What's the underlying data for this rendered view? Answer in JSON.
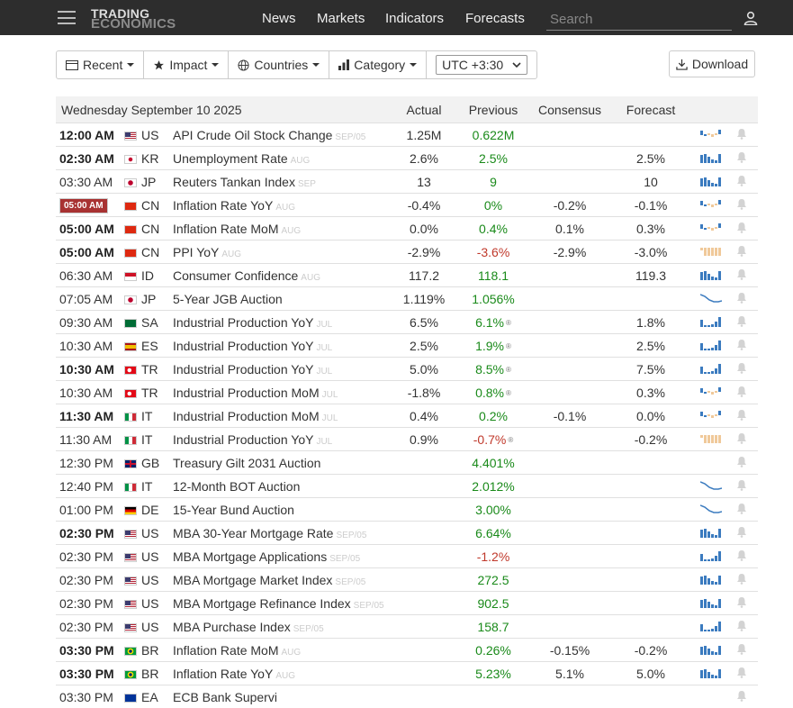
{
  "header": {
    "logo_line1": "TRADING",
    "logo_line2": "ECONOMICS",
    "nav": [
      "News",
      "Markets",
      "Indicators",
      "Forecasts"
    ],
    "search_placeholder": "Search"
  },
  "toolbar": {
    "recent": "Recent",
    "impact": "Impact",
    "countries": "Countries",
    "category": "Category",
    "timezone": "UTC +3:30",
    "download": "Download"
  },
  "colors": {
    "topbar": "#2d2d2d",
    "positive": "#1a8a1a",
    "negative": "#c0392b",
    "badge": "#a83232",
    "spark": "#3b7bbf",
    "spark_warn": "#f0c99a"
  },
  "table": {
    "date": "Wednesday September 10 2025",
    "columns": [
      "Actual",
      "Previous",
      "Consensus",
      "Forecast"
    ],
    "rows": [
      {
        "time": "12:00 AM",
        "bold": true,
        "country": "US",
        "event": "API Crude Oil Stock Change",
        "ref": "SEP/05",
        "actual": "1.25M",
        "previous": "0.622M",
        "prev_color": "pos",
        "consensus": "",
        "forecast": "",
        "spark": "mixed-small"
      },
      {
        "time": "02:30 AM",
        "bold": true,
        "country": "KR",
        "event": "Unemployment Rate",
        "ref": "AUG",
        "actual": "2.6%",
        "previous": "2.5%",
        "prev_color": "pos",
        "consensus": "",
        "forecast": "2.5%",
        "spark": "bars"
      },
      {
        "time": "03:30 AM",
        "country": "JP",
        "event": "Reuters Tankan Index",
        "ref": "SEP",
        "actual": "13",
        "previous": "9",
        "prev_color": "pos",
        "consensus": "",
        "forecast": "10",
        "spark": "bars"
      },
      {
        "time": "05:00 AM",
        "badge": true,
        "country": "CN",
        "event": "Inflation Rate YoY",
        "ref": "AUG",
        "actual": "-0.4%",
        "previous": "0%",
        "prev_color": "pos",
        "consensus": "-0.2%",
        "forecast": "-0.1%",
        "spark": "mixed-small"
      },
      {
        "time": "05:00 AM",
        "bold": true,
        "country": "CN",
        "event": "Inflation Rate MoM",
        "ref": "AUG",
        "actual": "0.0%",
        "previous": "0.4%",
        "prev_color": "pos",
        "consensus": "0.1%",
        "forecast": "0.3%",
        "spark": "mixed-small"
      },
      {
        "time": "05:00 AM",
        "bold": true,
        "country": "CN",
        "event": "PPI YoY",
        "ref": "AUG",
        "actual": "-2.9%",
        "previous": "-3.6%",
        "prev_color": "neg",
        "consensus": "-2.9%",
        "forecast": "-3.0%",
        "spark": "warn"
      },
      {
        "time": "06:30 AM",
        "country": "ID",
        "event": "Consumer Confidence",
        "ref": "AUG",
        "actual": "117.2",
        "previous": "118.1",
        "prev_color": "pos",
        "consensus": "",
        "forecast": "119.3",
        "spark": "bars"
      },
      {
        "time": "07:05 AM",
        "country": "JP",
        "event": "5-Year JGB Auction",
        "ref": "",
        "actual": "1.119%",
        "previous": "1.056%",
        "prev_color": "pos",
        "consensus": "",
        "forecast": "",
        "spark": "line-down"
      },
      {
        "time": "09:30 AM",
        "country": "SA",
        "event": "Industrial Production YoY",
        "ref": "JUL",
        "actual": "6.5%",
        "previous": "6.1%",
        "prev_color": "pos",
        "revised": true,
        "consensus": "",
        "forecast": "1.8%",
        "spark": "bars-low"
      },
      {
        "time": "10:30 AM",
        "country": "ES",
        "event": "Industrial Production YoY",
        "ref": "JUL",
        "actual": "2.5%",
        "previous": "1.9%",
        "prev_color": "pos",
        "revised": true,
        "consensus": "",
        "forecast": "2.5%",
        "spark": "bars-low"
      },
      {
        "time": "10:30 AM",
        "bold": true,
        "country": "TR",
        "event": "Industrial Production YoY",
        "ref": "JUL",
        "actual": "5.0%",
        "previous": "8.5%",
        "prev_color": "pos",
        "revised": true,
        "consensus": "",
        "forecast": "7.5%",
        "spark": "bars-low"
      },
      {
        "time": "10:30 AM",
        "country": "TR",
        "event": "Industrial Production MoM",
        "ref": "JUL",
        "actual": "-1.8%",
        "previous": "0.8%",
        "prev_color": "pos",
        "revised": true,
        "consensus": "",
        "forecast": "0.3%",
        "spark": "mixed-small"
      },
      {
        "time": "11:30 AM",
        "bold": true,
        "country": "IT",
        "event": "Industrial Production MoM",
        "ref": "JUL",
        "actual": "0.4%",
        "previous": "0.2%",
        "prev_color": "pos",
        "consensus": "-0.1%",
        "forecast": "0.0%",
        "spark": "mixed-small"
      },
      {
        "time": "11:30 AM",
        "country": "IT",
        "event": "Industrial Production YoY",
        "ref": "JUL",
        "actual": "0.9%",
        "previous": "-0.7%",
        "prev_color": "neg",
        "revised": true,
        "consensus": "",
        "forecast": "-0.2%",
        "spark": "warn"
      },
      {
        "time": "12:30 PM",
        "country": "GB",
        "event": "Treasury Gilt 2031 Auction",
        "ref": "",
        "actual": "",
        "previous": "4.401%",
        "prev_color": "pos",
        "consensus": "",
        "forecast": "",
        "spark": "none"
      },
      {
        "time": "12:40 PM",
        "country": "IT",
        "event": "12-Month BOT Auction",
        "ref": "",
        "actual": "",
        "previous": "2.012%",
        "prev_color": "pos",
        "consensus": "",
        "forecast": "",
        "spark": "line-down"
      },
      {
        "time": "01:00 PM",
        "country": "DE",
        "event": "15-Year Bund Auction",
        "ref": "",
        "actual": "",
        "previous": "3.00%",
        "prev_color": "pos",
        "consensus": "",
        "forecast": "",
        "spark": "line-down"
      },
      {
        "time": "02:30 PM",
        "bold": true,
        "country": "US",
        "event": "MBA 30-Year Mortgage Rate",
        "ref": "SEP/05",
        "actual": "",
        "previous": "6.64%",
        "prev_color": "pos",
        "consensus": "",
        "forecast": "",
        "spark": "bars"
      },
      {
        "time": "02:30 PM",
        "country": "US",
        "event": "MBA Mortgage Applications",
        "ref": "SEP/05",
        "actual": "",
        "previous": "-1.2%",
        "prev_color": "neg",
        "consensus": "",
        "forecast": "",
        "spark": "bars-low"
      },
      {
        "time": "02:30 PM",
        "country": "US",
        "event": "MBA Mortgage Market Index",
        "ref": "SEP/05",
        "actual": "",
        "previous": "272.5",
        "prev_color": "pos",
        "consensus": "",
        "forecast": "",
        "spark": "bars"
      },
      {
        "time": "02:30 PM",
        "country": "US",
        "event": "MBA Mortgage Refinance Index",
        "ref": "SEP/05",
        "actual": "",
        "previous": "902.5",
        "prev_color": "pos",
        "consensus": "",
        "forecast": "",
        "spark": "bars"
      },
      {
        "time": "02:30 PM",
        "country": "US",
        "event": "MBA Purchase Index",
        "ref": "SEP/05",
        "actual": "",
        "previous": "158.7",
        "prev_color": "pos",
        "consensus": "",
        "forecast": "",
        "spark": "bars-low"
      },
      {
        "time": "03:30 PM",
        "bold": true,
        "country": "BR",
        "event": "Inflation Rate MoM",
        "ref": "AUG",
        "actual": "",
        "previous": "0.26%",
        "prev_color": "pos",
        "consensus": "-0.15%",
        "forecast": "-0.2%",
        "spark": "bars"
      },
      {
        "time": "03:30 PM",
        "bold": true,
        "country": "BR",
        "event": "Inflation Rate YoY",
        "ref": "AUG",
        "actual": "",
        "previous": "5.23%",
        "prev_color": "pos",
        "consensus": "5.1%",
        "forecast": "5.0%",
        "spark": "bars"
      },
      {
        "time": "03:30 PM",
        "country": "EA",
        "event": "ECB Bank Supervi",
        "ref": "",
        "actual": "",
        "previous": "",
        "prev_color": "pos",
        "consensus": "",
        "forecast": "",
        "spark": "none"
      }
    ]
  }
}
